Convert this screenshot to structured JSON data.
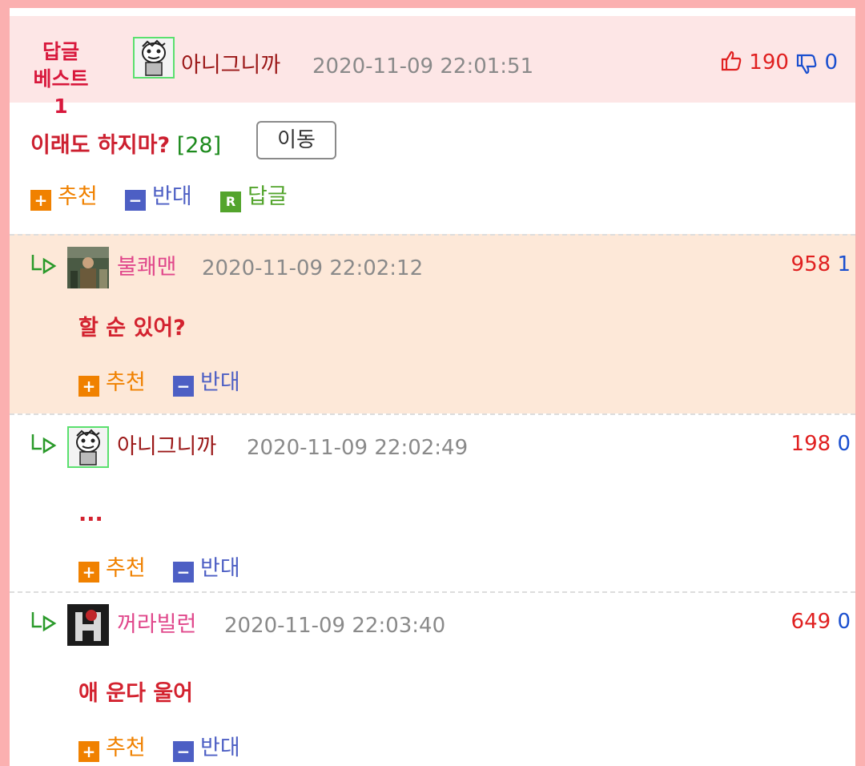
{
  "best": {
    "label_line1": "답글",
    "label_line2": "베스트1",
    "author": "아니그니까",
    "timestamp": "2020-11-09 22:01:51",
    "upvotes": "190",
    "downvotes": "0",
    "title": "이래도 하지마?",
    "reply_count": "[28]",
    "move_label": "이동",
    "actions": {
      "recommend": "추천",
      "oppose": "반대",
      "reply": "답글"
    }
  },
  "replies": [
    {
      "author": "불쾌맨",
      "author_color": "#e0478b",
      "timestamp": "2020-11-09 22:02:12",
      "upvotes": "958",
      "downvotes": "1",
      "body": "할 순 있어?",
      "bg": "#fde8d8",
      "avatar": "photo-icon"
    },
    {
      "author": "아니그니까",
      "author_color": "#9b1818",
      "timestamp": "2020-11-09 22:02:49",
      "upvotes": "198",
      "downvotes": "0",
      "body": "...",
      "bg": "#ffffff",
      "avatar": "cartoon-icon"
    },
    {
      "author": "꺼라빌런",
      "author_color": "#e0478b",
      "timestamp": "2020-11-09 22:03:40",
      "upvotes": "649",
      "downvotes": "0",
      "body": "애 운다 울어",
      "bg": "#ffffff",
      "avatar": "h-logo-icon"
    }
  ],
  "reply_actions": {
    "recommend": "추천",
    "oppose": "반대"
  },
  "colors": {
    "frame": "#fbb0b0",
    "best_bg": "#fde6e6",
    "up": "#e02020",
    "down": "#1a4fcf"
  }
}
